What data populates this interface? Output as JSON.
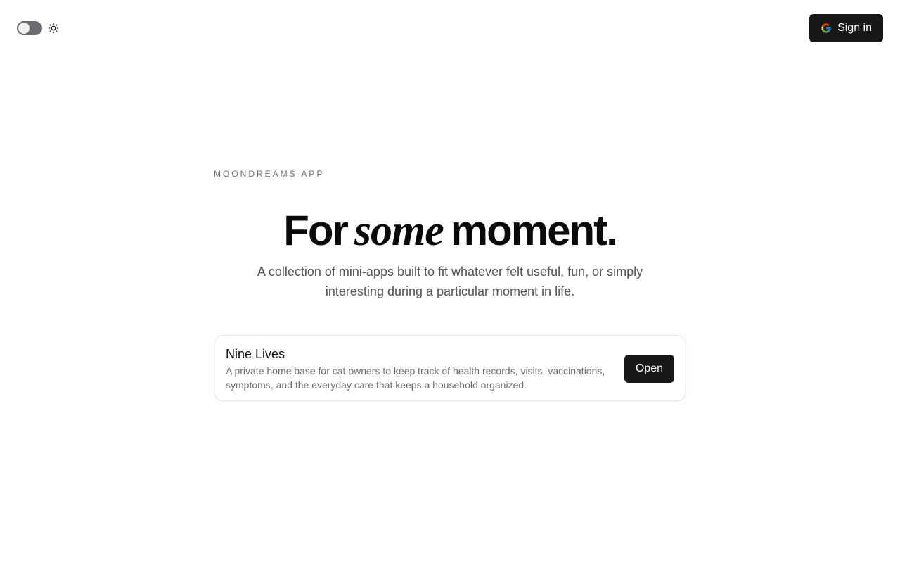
{
  "header": {
    "theme_toggle": {
      "state": "light",
      "icon": "sun-icon"
    },
    "sign_in": {
      "label": "Sign in",
      "icon": "google-icon"
    }
  },
  "hero": {
    "eyebrow": "MOONDREAMS APP",
    "headline_before": "For",
    "headline_accent": "some",
    "headline_after": "moment.",
    "subtitle": "A collection of mini-apps built to fit whatever felt useful, fun, or simply interesting during a particular moment in life."
  },
  "apps": [
    {
      "title": "Nine Lives",
      "description": "A private home base for cat owners to keep track of health records, visits, vaccinations, symptoms, and the everyday care that keeps a household organized.",
      "action_label": "Open"
    }
  ],
  "colors": {
    "primary_button": "#18181b",
    "toggle_track": "#6b6b70",
    "google_blue": "#4285F4",
    "google_red": "#EA4335",
    "google_yellow": "#FBBC05",
    "google_green": "#34A853"
  }
}
